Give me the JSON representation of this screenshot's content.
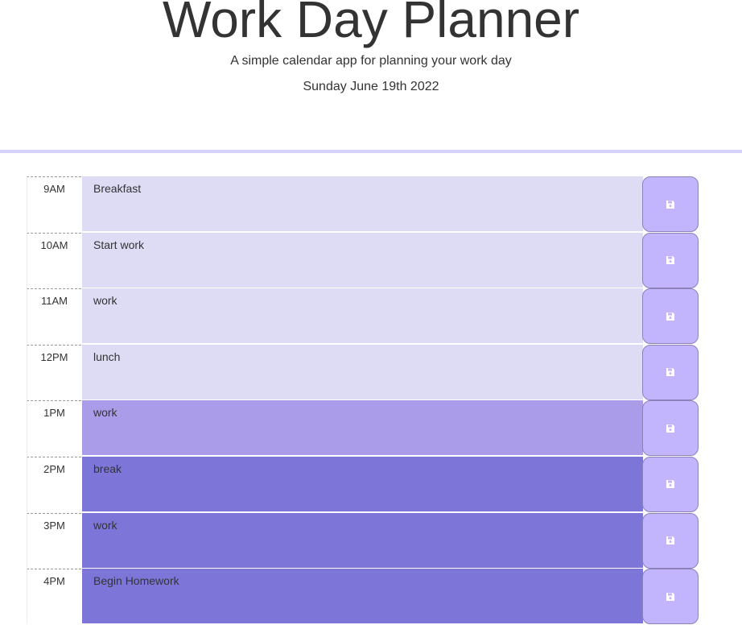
{
  "header": {
    "title": "Work Day Planner",
    "subtitle": "A simple calendar app for planning your work day",
    "current_day": "Sunday June 19th 2022"
  },
  "colors": {
    "past": "#dddcf4",
    "present": "#ab9ce9",
    "future": "#7d76d8",
    "save_button": "#c2b5fd",
    "divider": "#d4d2fb"
  },
  "save_icon": "floppy-disk-icon",
  "time_blocks": [
    {
      "hour": "9AM",
      "text": "Breakfast",
      "state": "past"
    },
    {
      "hour": "10AM",
      "text": "Start work",
      "state": "past"
    },
    {
      "hour": "11AM",
      "text": "work",
      "state": "past"
    },
    {
      "hour": "12PM",
      "text": "lunch",
      "state": "past"
    },
    {
      "hour": "1PM",
      "text": "work",
      "state": "present"
    },
    {
      "hour": "2PM",
      "text": "break",
      "state": "future"
    },
    {
      "hour": "3PM",
      "text": "work",
      "state": "future"
    },
    {
      "hour": "4PM",
      "text": "Begin Homework",
      "state": "future"
    }
  ]
}
